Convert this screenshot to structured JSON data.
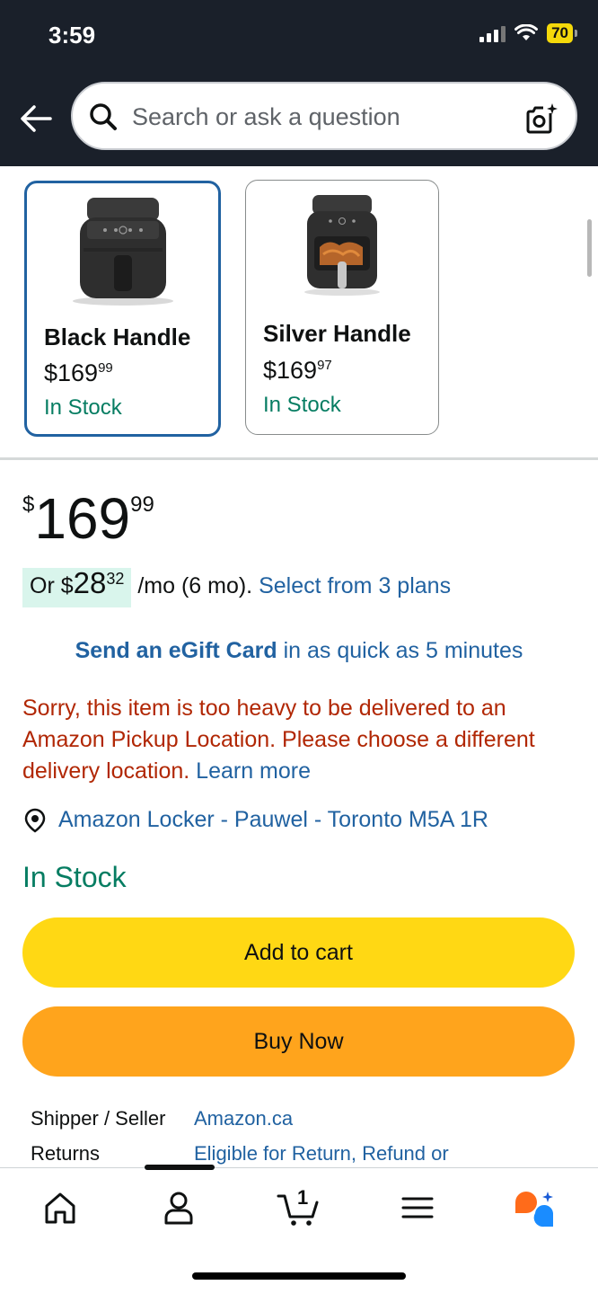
{
  "status_bar": {
    "time": "3:59",
    "battery": "70"
  },
  "search": {
    "placeholder": "Search or ask a question"
  },
  "variations": [
    {
      "name": "Black Handle",
      "price_whole": "$169",
      "price_fraction": "99",
      "availability": "In Stock",
      "selected": true
    },
    {
      "name": "Silver Handle",
      "price_whole": "$169",
      "price_fraction": "97",
      "availability": "In Stock",
      "selected": false
    }
  ],
  "price": {
    "currency": "$",
    "whole": "169",
    "fraction": "99"
  },
  "installment": {
    "prefix": "Or $",
    "amount_whole": "28",
    "amount_fraction": "32",
    "suffix": "/mo (6 mo).",
    "link": "Select from 3 plans"
  },
  "egift": {
    "bold": "Send an eGift Card",
    "rest": " in as quick as 5 minutes"
  },
  "warning": {
    "text": "Sorry, this item is too heavy to be delivered to an Amazon Pickup Location. Please choose a different delivery location.",
    "link": "Learn more"
  },
  "delivery_location": "Amazon Locker - Pauwel - Toronto M5A 1R",
  "stock_status": "In Stock",
  "buttons": {
    "add_to_cart": "Add to cart",
    "buy_now": "Buy Now"
  },
  "details": [
    {
      "label": "Shipper / Seller",
      "value": "Amazon.ca"
    },
    {
      "label": "Returns",
      "value": "Eligible for Return, Refund or"
    }
  ],
  "bottom_nav": {
    "cart_count": "1"
  },
  "colors": {
    "top_bar": "#1a202a",
    "add_to_cart": "#ffd814",
    "buy_now": "#ffa41c",
    "link": "#2162a1",
    "in_stock": "#067d62",
    "warning": "#b12704"
  }
}
